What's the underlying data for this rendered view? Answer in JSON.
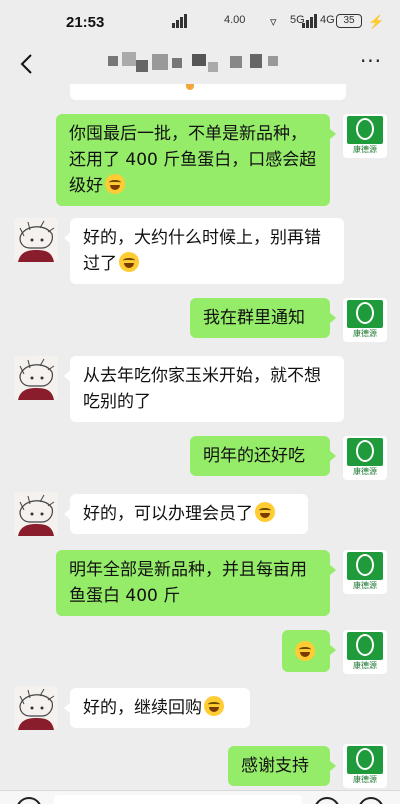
{
  "status_bar": {
    "time": "21:53",
    "network_rate": "4.00",
    "wifi": "▿",
    "net_5g": "5G",
    "net_4g": "4G",
    "battery": "35",
    "charging": "⚡"
  },
  "nav": {
    "more": "···"
  },
  "messages": [
    {
      "side": "sent",
      "text": "你囤最后一批，不单是新品种，还用了 400 斤鱼蛋白，口感会超级好",
      "emoji": true
    },
    {
      "side": "recv",
      "text": "好的，大约什么时候上，别再错过了",
      "emoji": true
    },
    {
      "side": "sent",
      "text": "我在群里通知",
      "emoji": false
    },
    {
      "side": "recv",
      "text": "从去年吃你家玉米开始，就不想吃别的了",
      "emoji": false
    },
    {
      "side": "sent",
      "text": "明年的还好吃",
      "emoji": false
    },
    {
      "side": "recv",
      "text": "好的，可以办理会员了",
      "emoji": true
    },
    {
      "side": "sent",
      "text": "明年全部是新品种，并且每亩用鱼蛋白 400 斤",
      "emoji": false
    },
    {
      "side": "sent",
      "text": "",
      "emoji": true
    },
    {
      "side": "recv",
      "text": "好的，继续回购",
      "emoji": true
    },
    {
      "side": "sent",
      "text": "感谢支持",
      "emoji": false
    }
  ],
  "biz_avatar": {
    "logo_text": "康德源"
  },
  "colors": {
    "sent_bubble": "#95ec69",
    "recv_bubble": "#ffffff",
    "background": "#ededed",
    "logo_green": "#1f9b3b"
  }
}
